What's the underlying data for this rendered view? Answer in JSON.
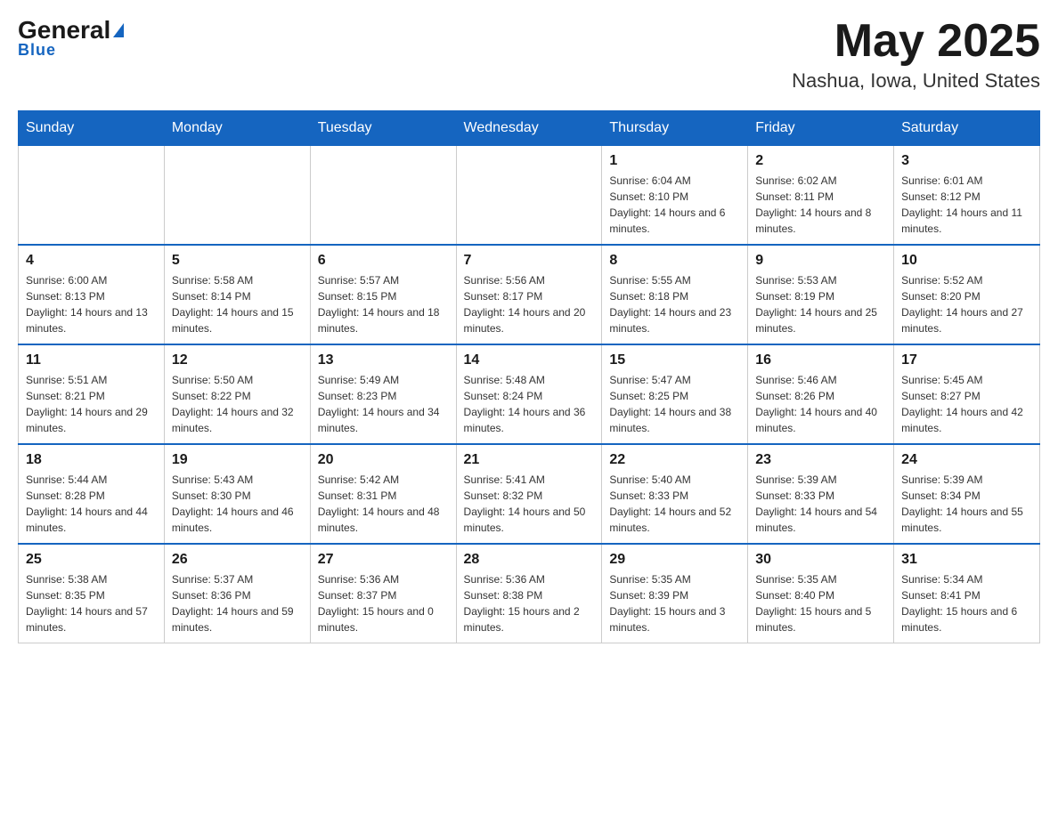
{
  "header": {
    "logo": {
      "general": "General",
      "blue": "Blue"
    },
    "title": "May 2025",
    "location": "Nashua, Iowa, United States"
  },
  "days_of_week": [
    "Sunday",
    "Monday",
    "Tuesday",
    "Wednesday",
    "Thursday",
    "Friday",
    "Saturday"
  ],
  "weeks": [
    [
      {
        "day": "",
        "info": ""
      },
      {
        "day": "",
        "info": ""
      },
      {
        "day": "",
        "info": ""
      },
      {
        "day": "",
        "info": ""
      },
      {
        "day": "1",
        "info": "Sunrise: 6:04 AM\nSunset: 8:10 PM\nDaylight: 14 hours and 6 minutes."
      },
      {
        "day": "2",
        "info": "Sunrise: 6:02 AM\nSunset: 8:11 PM\nDaylight: 14 hours and 8 minutes."
      },
      {
        "day": "3",
        "info": "Sunrise: 6:01 AM\nSunset: 8:12 PM\nDaylight: 14 hours and 11 minutes."
      }
    ],
    [
      {
        "day": "4",
        "info": "Sunrise: 6:00 AM\nSunset: 8:13 PM\nDaylight: 14 hours and 13 minutes."
      },
      {
        "day": "5",
        "info": "Sunrise: 5:58 AM\nSunset: 8:14 PM\nDaylight: 14 hours and 15 minutes."
      },
      {
        "day": "6",
        "info": "Sunrise: 5:57 AM\nSunset: 8:15 PM\nDaylight: 14 hours and 18 minutes."
      },
      {
        "day": "7",
        "info": "Sunrise: 5:56 AM\nSunset: 8:17 PM\nDaylight: 14 hours and 20 minutes."
      },
      {
        "day": "8",
        "info": "Sunrise: 5:55 AM\nSunset: 8:18 PM\nDaylight: 14 hours and 23 minutes."
      },
      {
        "day": "9",
        "info": "Sunrise: 5:53 AM\nSunset: 8:19 PM\nDaylight: 14 hours and 25 minutes."
      },
      {
        "day": "10",
        "info": "Sunrise: 5:52 AM\nSunset: 8:20 PM\nDaylight: 14 hours and 27 minutes."
      }
    ],
    [
      {
        "day": "11",
        "info": "Sunrise: 5:51 AM\nSunset: 8:21 PM\nDaylight: 14 hours and 29 minutes."
      },
      {
        "day": "12",
        "info": "Sunrise: 5:50 AM\nSunset: 8:22 PM\nDaylight: 14 hours and 32 minutes."
      },
      {
        "day": "13",
        "info": "Sunrise: 5:49 AM\nSunset: 8:23 PM\nDaylight: 14 hours and 34 minutes."
      },
      {
        "day": "14",
        "info": "Sunrise: 5:48 AM\nSunset: 8:24 PM\nDaylight: 14 hours and 36 minutes."
      },
      {
        "day": "15",
        "info": "Sunrise: 5:47 AM\nSunset: 8:25 PM\nDaylight: 14 hours and 38 minutes."
      },
      {
        "day": "16",
        "info": "Sunrise: 5:46 AM\nSunset: 8:26 PM\nDaylight: 14 hours and 40 minutes."
      },
      {
        "day": "17",
        "info": "Sunrise: 5:45 AM\nSunset: 8:27 PM\nDaylight: 14 hours and 42 minutes."
      }
    ],
    [
      {
        "day": "18",
        "info": "Sunrise: 5:44 AM\nSunset: 8:28 PM\nDaylight: 14 hours and 44 minutes."
      },
      {
        "day": "19",
        "info": "Sunrise: 5:43 AM\nSunset: 8:30 PM\nDaylight: 14 hours and 46 minutes."
      },
      {
        "day": "20",
        "info": "Sunrise: 5:42 AM\nSunset: 8:31 PM\nDaylight: 14 hours and 48 minutes."
      },
      {
        "day": "21",
        "info": "Sunrise: 5:41 AM\nSunset: 8:32 PM\nDaylight: 14 hours and 50 minutes."
      },
      {
        "day": "22",
        "info": "Sunrise: 5:40 AM\nSunset: 8:33 PM\nDaylight: 14 hours and 52 minutes."
      },
      {
        "day": "23",
        "info": "Sunrise: 5:39 AM\nSunset: 8:33 PM\nDaylight: 14 hours and 54 minutes."
      },
      {
        "day": "24",
        "info": "Sunrise: 5:39 AM\nSunset: 8:34 PM\nDaylight: 14 hours and 55 minutes."
      }
    ],
    [
      {
        "day": "25",
        "info": "Sunrise: 5:38 AM\nSunset: 8:35 PM\nDaylight: 14 hours and 57 minutes."
      },
      {
        "day": "26",
        "info": "Sunrise: 5:37 AM\nSunset: 8:36 PM\nDaylight: 14 hours and 59 minutes."
      },
      {
        "day": "27",
        "info": "Sunrise: 5:36 AM\nSunset: 8:37 PM\nDaylight: 15 hours and 0 minutes."
      },
      {
        "day": "28",
        "info": "Sunrise: 5:36 AM\nSunset: 8:38 PM\nDaylight: 15 hours and 2 minutes."
      },
      {
        "day": "29",
        "info": "Sunrise: 5:35 AM\nSunset: 8:39 PM\nDaylight: 15 hours and 3 minutes."
      },
      {
        "day": "30",
        "info": "Sunrise: 5:35 AM\nSunset: 8:40 PM\nDaylight: 15 hours and 5 minutes."
      },
      {
        "day": "31",
        "info": "Sunrise: 5:34 AM\nSunset: 8:41 PM\nDaylight: 15 hours and 6 minutes."
      }
    ]
  ]
}
